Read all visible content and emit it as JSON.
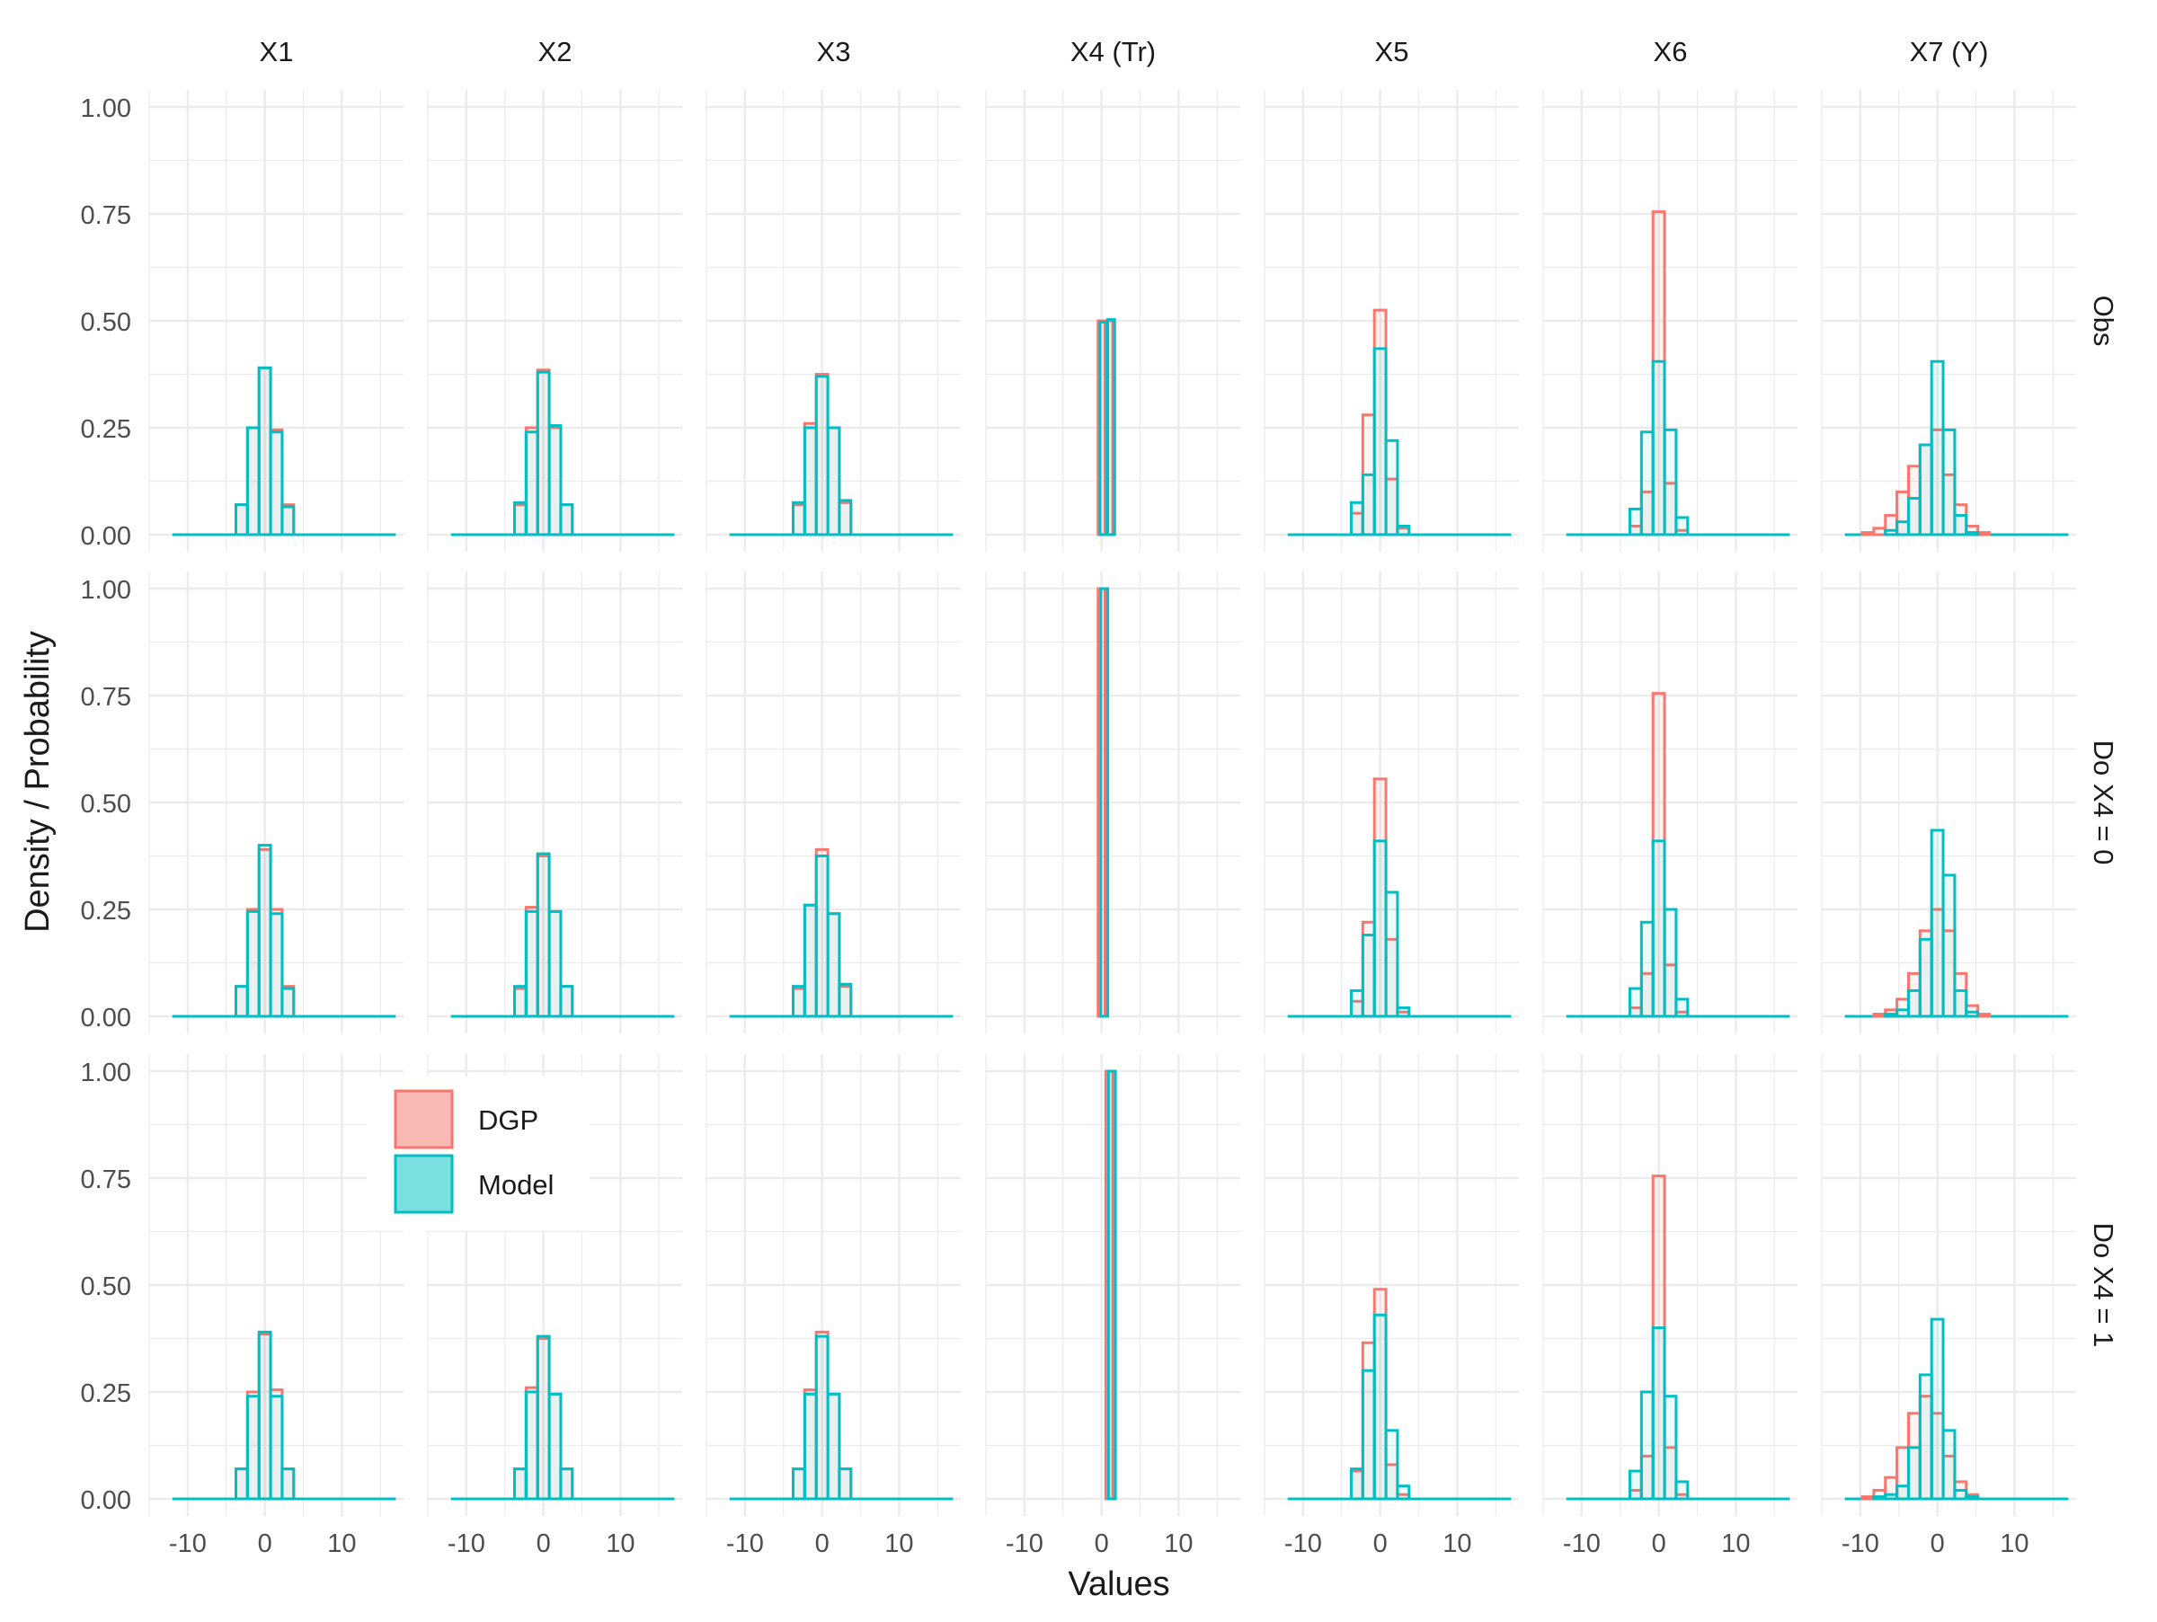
{
  "chart_data": {
    "type": "bar",
    "subtype": "faceted-histogram",
    "xlabel": "Values",
    "ylabel": "Density / Probability",
    "xlim": [
      -15,
      18
    ],
    "ylim": [
      -0.04,
      1.04
    ],
    "x_ticks": [
      -10,
      0,
      10
    ],
    "x_tick_labels": [
      "-10",
      "0",
      "10"
    ],
    "y_ticks": [
      0,
      0.25,
      0.5,
      0.75,
      1
    ],
    "y_tick_labels": [
      "0.00",
      "0.25",
      "0.50",
      "0.75",
      "1.00"
    ],
    "grid": true,
    "legend": {
      "placement": "inside-left",
      "entries": [
        {
          "name": "DGP",
          "fill": "#F8B9B4",
          "stroke": "#F8766D"
        },
        {
          "name": "Model",
          "fill": "#7ADFE1",
          "stroke": "#00BFC4"
        }
      ]
    },
    "columns": [
      "X1",
      "X2",
      "X3",
      "X4 (Tr)",
      "X5",
      "X6",
      "X7 (Y)"
    ],
    "rows": [
      "Obs",
      "Do X4 = 0",
      "Do X4 = 1"
    ],
    "bins": [
      -14,
      -12,
      -10,
      -8,
      -6,
      -4,
      -2,
      0,
      2,
      4,
      6,
      8,
      10,
      12,
      14,
      16
    ],
    "colors": {
      "dgp": "#F8766D",
      "model": "#00BFC4",
      "grid": "#EBEBEB",
      "text": "#4D4D4D"
    },
    "panels": [
      {
        "row": "Obs",
        "col": "X1",
        "bars": [
          {
            "x": -3,
            "DGP": 0.07,
            "Model": 0.07
          },
          {
            "x": -1.5,
            "DGP": 0.25,
            "Model": 0.25
          },
          {
            "x": 0,
            "DGP": 0.39,
            "Model": 0.39
          },
          {
            "x": 1.5,
            "DGP": 0.245,
            "Model": 0.24
          },
          {
            "x": 3,
            "DGP": 0.07,
            "Model": 0.065
          }
        ]
      },
      {
        "row": "Obs",
        "col": "X2",
        "bars": [
          {
            "x": -3,
            "DGP": 0.07,
            "Model": 0.075
          },
          {
            "x": -1.5,
            "DGP": 0.25,
            "Model": 0.24
          },
          {
            "x": 0,
            "DGP": 0.385,
            "Model": 0.38
          },
          {
            "x": 1.5,
            "DGP": 0.25,
            "Model": 0.255
          },
          {
            "x": 3,
            "DGP": 0.07,
            "Model": 0.07
          }
        ]
      },
      {
        "row": "Obs",
        "col": "X3",
        "bars": [
          {
            "x": -3,
            "DGP": 0.07,
            "Model": 0.075
          },
          {
            "x": -1.5,
            "DGP": 0.26,
            "Model": 0.25
          },
          {
            "x": 0,
            "DGP": 0.375,
            "Model": 0.37
          },
          {
            "x": 1.5,
            "DGP": 0.25,
            "Model": 0.25
          },
          {
            "x": 3,
            "DGP": 0.075,
            "Model": 0.08
          }
        ]
      },
      {
        "row": "Obs",
        "col": "X4 (Tr)",
        "bars": [
          {
            "x": 0,
            "DGP": 0.5,
            "Model": 0.497
          },
          {
            "x": 1,
            "DGP": 0.5,
            "Model": 0.503
          }
        ]
      },
      {
        "row": "Obs",
        "col": "X5",
        "bars": [
          {
            "x": -3,
            "DGP": 0.05,
            "Model": 0.075
          },
          {
            "x": -1.5,
            "DGP": 0.28,
            "Model": 0.14
          },
          {
            "x": 0,
            "DGP": 0.525,
            "Model": 0.435
          },
          {
            "x": 1.5,
            "DGP": 0.13,
            "Model": 0.22
          },
          {
            "x": 3,
            "DGP": 0.015,
            "Model": 0.02
          }
        ]
      },
      {
        "row": "Obs",
        "col": "X6",
        "bars": [
          {
            "x": -3,
            "DGP": 0.02,
            "Model": 0.06
          },
          {
            "x": -1.5,
            "DGP": 0.1,
            "Model": 0.24
          },
          {
            "x": 0,
            "DGP": 0.755,
            "Model": 0.405
          },
          {
            "x": 1.5,
            "DGP": 0.12,
            "Model": 0.245
          },
          {
            "x": 3,
            "DGP": 0.01,
            "Model": 0.04
          }
        ]
      },
      {
        "row": "Obs",
        "col": "X7 (Y)",
        "bars": [
          {
            "x": -9,
            "DGP": 0.005,
            "Model": 0
          },
          {
            "x": -7.5,
            "DGP": 0.015,
            "Model": 0
          },
          {
            "x": -6,
            "DGP": 0.045,
            "Model": 0.01
          },
          {
            "x": -4.5,
            "DGP": 0.1,
            "Model": 0.03
          },
          {
            "x": -3,
            "DGP": 0.16,
            "Model": 0.085
          },
          {
            "x": -1.5,
            "DGP": 0.21,
            "Model": 0.21
          },
          {
            "x": 0,
            "DGP": 0.245,
            "Model": 0.405
          },
          {
            "x": 1.5,
            "DGP": 0.14,
            "Model": 0.245
          },
          {
            "x": 3,
            "DGP": 0.07,
            "Model": 0.045
          },
          {
            "x": 4.5,
            "DGP": 0.02,
            "Model": 0.005
          },
          {
            "x": 6,
            "DGP": 0.005,
            "Model": 0
          }
        ]
      },
      {
        "row": "Do X4 = 0",
        "col": "X1",
        "bars": [
          {
            "x": -3,
            "DGP": 0.07,
            "Model": 0.07
          },
          {
            "x": -1.5,
            "DGP": 0.25,
            "Model": 0.245
          },
          {
            "x": 0,
            "DGP": 0.39,
            "Model": 0.4
          },
          {
            "x": 1.5,
            "DGP": 0.25,
            "Model": 0.24
          },
          {
            "x": 3,
            "DGP": 0.07,
            "Model": 0.065
          }
        ]
      },
      {
        "row": "Do X4 = 0",
        "col": "X2",
        "bars": [
          {
            "x": -3,
            "DGP": 0.065,
            "Model": 0.07
          },
          {
            "x": -1.5,
            "DGP": 0.255,
            "Model": 0.245
          },
          {
            "x": 0,
            "DGP": 0.375,
            "Model": 0.38
          },
          {
            "x": 1.5,
            "DGP": 0.245,
            "Model": 0.245
          },
          {
            "x": 3,
            "DGP": 0.07,
            "Model": 0.07
          }
        ]
      },
      {
        "row": "Do X4 = 0",
        "col": "X3",
        "bars": [
          {
            "x": -3,
            "DGP": 0.065,
            "Model": 0.07
          },
          {
            "x": -1.5,
            "DGP": 0.26,
            "Model": 0.26
          },
          {
            "x": 0,
            "DGP": 0.39,
            "Model": 0.375
          },
          {
            "x": 1.5,
            "DGP": 0.24,
            "Model": 0.24
          },
          {
            "x": 3,
            "DGP": 0.07,
            "Model": 0.075
          }
        ]
      },
      {
        "row": "Do X4 = 0",
        "col": "X4 (Tr)",
        "bars": [
          {
            "x": 0,
            "DGP": 1,
            "Model": 1
          }
        ]
      },
      {
        "row": "Do X4 = 0",
        "col": "X5",
        "bars": [
          {
            "x": -3,
            "DGP": 0.035,
            "Model": 0.06
          },
          {
            "x": -1.5,
            "DGP": 0.22,
            "Model": 0.19
          },
          {
            "x": 0,
            "DGP": 0.555,
            "Model": 0.41
          },
          {
            "x": 1.5,
            "DGP": 0.18,
            "Model": 0.29
          },
          {
            "x": 3,
            "DGP": 0.01,
            "Model": 0.02
          }
        ]
      },
      {
        "row": "Do X4 = 0",
        "col": "X6",
        "bars": [
          {
            "x": -3,
            "DGP": 0.02,
            "Model": 0.065
          },
          {
            "x": -1.5,
            "DGP": 0.1,
            "Model": 0.22
          },
          {
            "x": 0,
            "DGP": 0.755,
            "Model": 0.41
          },
          {
            "x": 1.5,
            "DGP": 0.12,
            "Model": 0.25
          },
          {
            "x": 3,
            "DGP": 0.01,
            "Model": 0.04
          }
        ]
      },
      {
        "row": "Do X4 = 0",
        "col": "X7 (Y)",
        "bars": [
          {
            "x": -7.5,
            "DGP": 0.005,
            "Model": 0
          },
          {
            "x": -6,
            "DGP": 0.015,
            "Model": 0.005
          },
          {
            "x": -4.5,
            "DGP": 0.04,
            "Model": 0.015
          },
          {
            "x": -3,
            "DGP": 0.1,
            "Model": 0.06
          },
          {
            "x": -1.5,
            "DGP": 0.2,
            "Model": 0.18
          },
          {
            "x": 0,
            "DGP": 0.25,
            "Model": 0.435
          },
          {
            "x": 1.5,
            "DGP": 0.2,
            "Model": 0.33
          },
          {
            "x": 3,
            "DGP": 0.1,
            "Model": 0.06
          },
          {
            "x": 4.5,
            "DGP": 0.025,
            "Model": 0.01
          },
          {
            "x": 6,
            "DGP": 0.005,
            "Model": 0
          }
        ]
      },
      {
        "row": "Do X4 = 1",
        "col": "X1",
        "bars": [
          {
            "x": -3,
            "DGP": 0.07,
            "Model": 0.07
          },
          {
            "x": -1.5,
            "DGP": 0.25,
            "Model": 0.24
          },
          {
            "x": 0,
            "DGP": 0.385,
            "Model": 0.39
          },
          {
            "x": 1.5,
            "DGP": 0.255,
            "Model": 0.24
          },
          {
            "x": 3,
            "DGP": 0.07,
            "Model": 0.07
          }
        ]
      },
      {
        "row": "Do X4 = 1",
        "col": "X2",
        "bars": [
          {
            "x": -3,
            "DGP": 0.07,
            "Model": 0.07
          },
          {
            "x": -1.5,
            "DGP": 0.26,
            "Model": 0.25
          },
          {
            "x": 0,
            "DGP": 0.375,
            "Model": 0.38
          },
          {
            "x": 1.5,
            "DGP": 0.245,
            "Model": 0.245
          },
          {
            "x": 3,
            "DGP": 0.07,
            "Model": 0.07
          }
        ]
      },
      {
        "row": "Do X4 = 1",
        "col": "X3",
        "bars": [
          {
            "x": -3,
            "DGP": 0.07,
            "Model": 0.07
          },
          {
            "x": -1.5,
            "DGP": 0.255,
            "Model": 0.245
          },
          {
            "x": 0,
            "DGP": 0.39,
            "Model": 0.38
          },
          {
            "x": 1.5,
            "DGP": 0.245,
            "Model": 0.245
          },
          {
            "x": 3,
            "DGP": 0.07,
            "Model": 0.07
          }
        ]
      },
      {
        "row": "Do X4 = 1",
        "col": "X4 (Tr)",
        "bars": [
          {
            "x": 1,
            "DGP": 1,
            "Model": 1
          }
        ]
      },
      {
        "row": "Do X4 = 1",
        "col": "X5",
        "bars": [
          {
            "x": -3,
            "DGP": 0.065,
            "Model": 0.07
          },
          {
            "x": -1.5,
            "DGP": 0.365,
            "Model": 0.3
          },
          {
            "x": 0,
            "DGP": 0.49,
            "Model": 0.43
          },
          {
            "x": 1.5,
            "DGP": 0.08,
            "Model": 0.16
          },
          {
            "x": 3,
            "DGP": 0.01,
            "Model": 0.03
          }
        ]
      },
      {
        "row": "Do X4 = 1",
        "col": "X6",
        "bars": [
          {
            "x": -3,
            "DGP": 0.02,
            "Model": 0.065
          },
          {
            "x": -1.5,
            "DGP": 0.1,
            "Model": 0.25
          },
          {
            "x": 0,
            "DGP": 0.755,
            "Model": 0.4
          },
          {
            "x": 1.5,
            "DGP": 0.12,
            "Model": 0.24
          },
          {
            "x": 3,
            "DGP": 0.01,
            "Model": 0.04
          }
        ]
      },
      {
        "row": "Do X4 = 1",
        "col": "X7 (Y)",
        "bars": [
          {
            "x": -9,
            "DGP": 0.005,
            "Model": 0
          },
          {
            "x": -7.5,
            "DGP": 0.02,
            "Model": 0.005
          },
          {
            "x": -6,
            "DGP": 0.05,
            "Model": 0.01
          },
          {
            "x": -4.5,
            "DGP": 0.12,
            "Model": 0.03
          },
          {
            "x": -3,
            "DGP": 0.2,
            "Model": 0.12
          },
          {
            "x": -1.5,
            "DGP": 0.24,
            "Model": 0.29
          },
          {
            "x": 0,
            "DGP": 0.2,
            "Model": 0.42
          },
          {
            "x": 1.5,
            "DGP": 0.1,
            "Model": 0.16
          },
          {
            "x": 3,
            "DGP": 0.04,
            "Model": 0.02
          },
          {
            "x": 4.5,
            "DGP": 0.01,
            "Model": 0.005
          }
        ]
      }
    ]
  }
}
